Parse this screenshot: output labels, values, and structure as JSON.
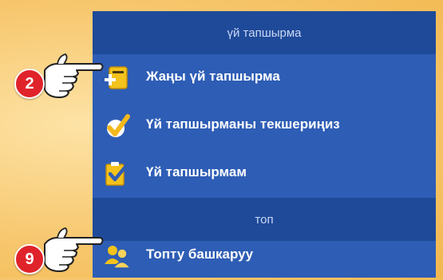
{
  "panel": {
    "header_homework": "үй тапшырма",
    "header_group": "топ",
    "items": [
      {
        "label": "Жаңы үй тапшырма",
        "icon": "new-homework-icon"
      },
      {
        "label": "Үй тапшырманы текшериңиз",
        "icon": "checkmark-icon"
      },
      {
        "label": "Үй тапшырмам",
        "icon": "checklist-icon"
      },
      {
        "label": "Топту башкаруу",
        "icon": "group-users-icon"
      }
    ]
  },
  "markers": [
    {
      "number": "2"
    },
    {
      "number": "9"
    }
  ],
  "colors": {
    "background": "#f7c76e",
    "panel": "#2e5db5",
    "header": "#1f4a99",
    "marker": "#e0232a"
  }
}
